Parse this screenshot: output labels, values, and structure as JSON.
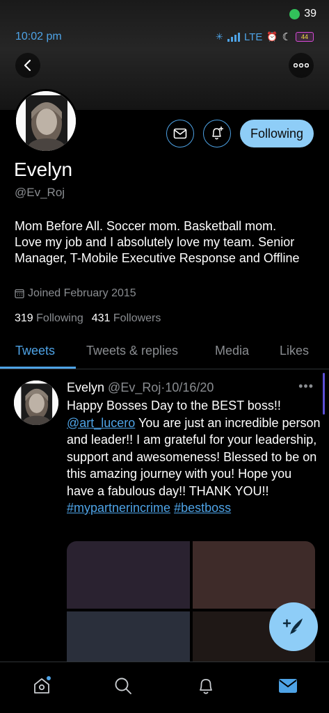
{
  "status_bar": {
    "counter": "39",
    "time": "10:02 pm",
    "network": "LTE",
    "battery": "44"
  },
  "profile": {
    "name": "Evelyn",
    "handle": "@Ev_Roj",
    "bio": "Mom Before All. Soccer mom. Basketball mom. Love my job and I absolutely love my team. Senior Manager, T-Mobile Executive Response and Offline",
    "joined": "Joined February 2015",
    "following_count": "319",
    "following_label": "Following",
    "followers_count": "431",
    "followers_label": "Followers",
    "follow_button": "Following"
  },
  "tabs": [
    {
      "label": "Tweets",
      "active": true
    },
    {
      "label": "Tweets & replies",
      "active": false
    },
    {
      "label": "Media",
      "active": false
    },
    {
      "label": "Likes",
      "active": false
    }
  ],
  "tweet": {
    "author": "Evelyn",
    "handle": "@Ev_Roj",
    "separator": "·",
    "date": "10/16/20",
    "text_start": "Happy Bosses Day to the BEST boss!! ",
    "mention": "@art_lucero",
    "text_mid": " You are just an incredible person and leader!! I am grateful for your leadership, support and awesomeness! Blessed to be on this amazing journey with you! Hope you have a fabulous day!! THANK YOU!! ",
    "hashtag1": "#mypartnerincrime",
    "hashtag2": "#bestboss"
  },
  "colors": {
    "accent": "#4ea3e6",
    "button_fill": "#8ecdf7",
    "muted_text": "#8a8d91"
  }
}
